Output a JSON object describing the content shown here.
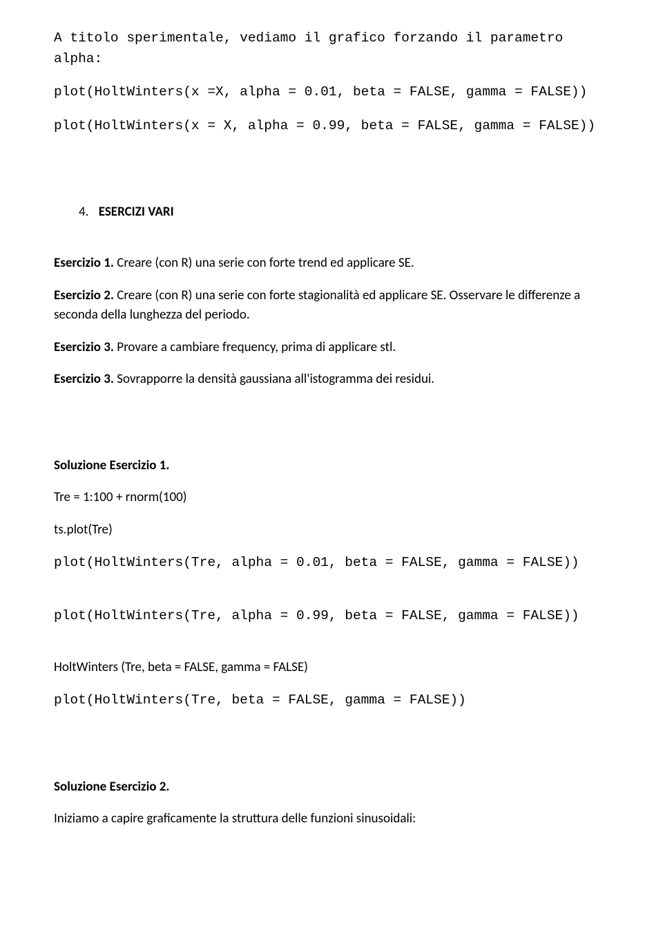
{
  "intro": {
    "line1": "A titolo sperimentale, vediamo il grafico forzando il parametro alpha:",
    "code1": "plot(HoltWinters(x =X, alpha = 0.01, beta = FALSE, gamma = FALSE))",
    "code2": "plot(HoltWinters(x = X, alpha = 0.99, beta = FALSE, gamma = FALSE))"
  },
  "section4": {
    "number": "4.",
    "title": "ESERCIZI VARI",
    "ex1_label": "Esercizio 1.",
    "ex1_text": " Creare (con R) una serie con forte trend ed applicare SE.",
    "ex2_label": "Esercizio 2.",
    "ex2_text": " Creare (con R) una serie con forte stagionalità ed applicare SE. Osservare le differenze a seconda della lunghezza del periodo.",
    "ex3_label": "Esercizio 3.",
    "ex3_text": " Provare a cambiare frequency, prima di applicare stl.",
    "ex3b_label": "Esercizio 3.",
    "ex3b_text": " Sovrapporre la densità gaussiana all'istogramma dei residui."
  },
  "sol1": {
    "heading": "Soluzione Esercizio 1.",
    "line_tre": "Tre = 1:100 + rnorm(100)",
    "line_tsplot": "ts.plot(Tre)",
    "code1": "plot(HoltWinters(Tre, alpha = 0.01, beta = FALSE, gamma = FALSE))",
    "code2": "plot(HoltWinters(Tre, alpha = 0.99, beta = FALSE, gamma = FALSE))",
    "line_hw": "HoltWinters (Tre, beta = FALSE, gamma = FALSE)",
    "code3": "plot(HoltWinters(Tre, beta = FALSE, gamma = FALSE))"
  },
  "sol2": {
    "heading": "Soluzione Esercizio 2.",
    "line1": "Iniziamo a capire graficamente la struttura delle funzioni sinusoidali:"
  }
}
